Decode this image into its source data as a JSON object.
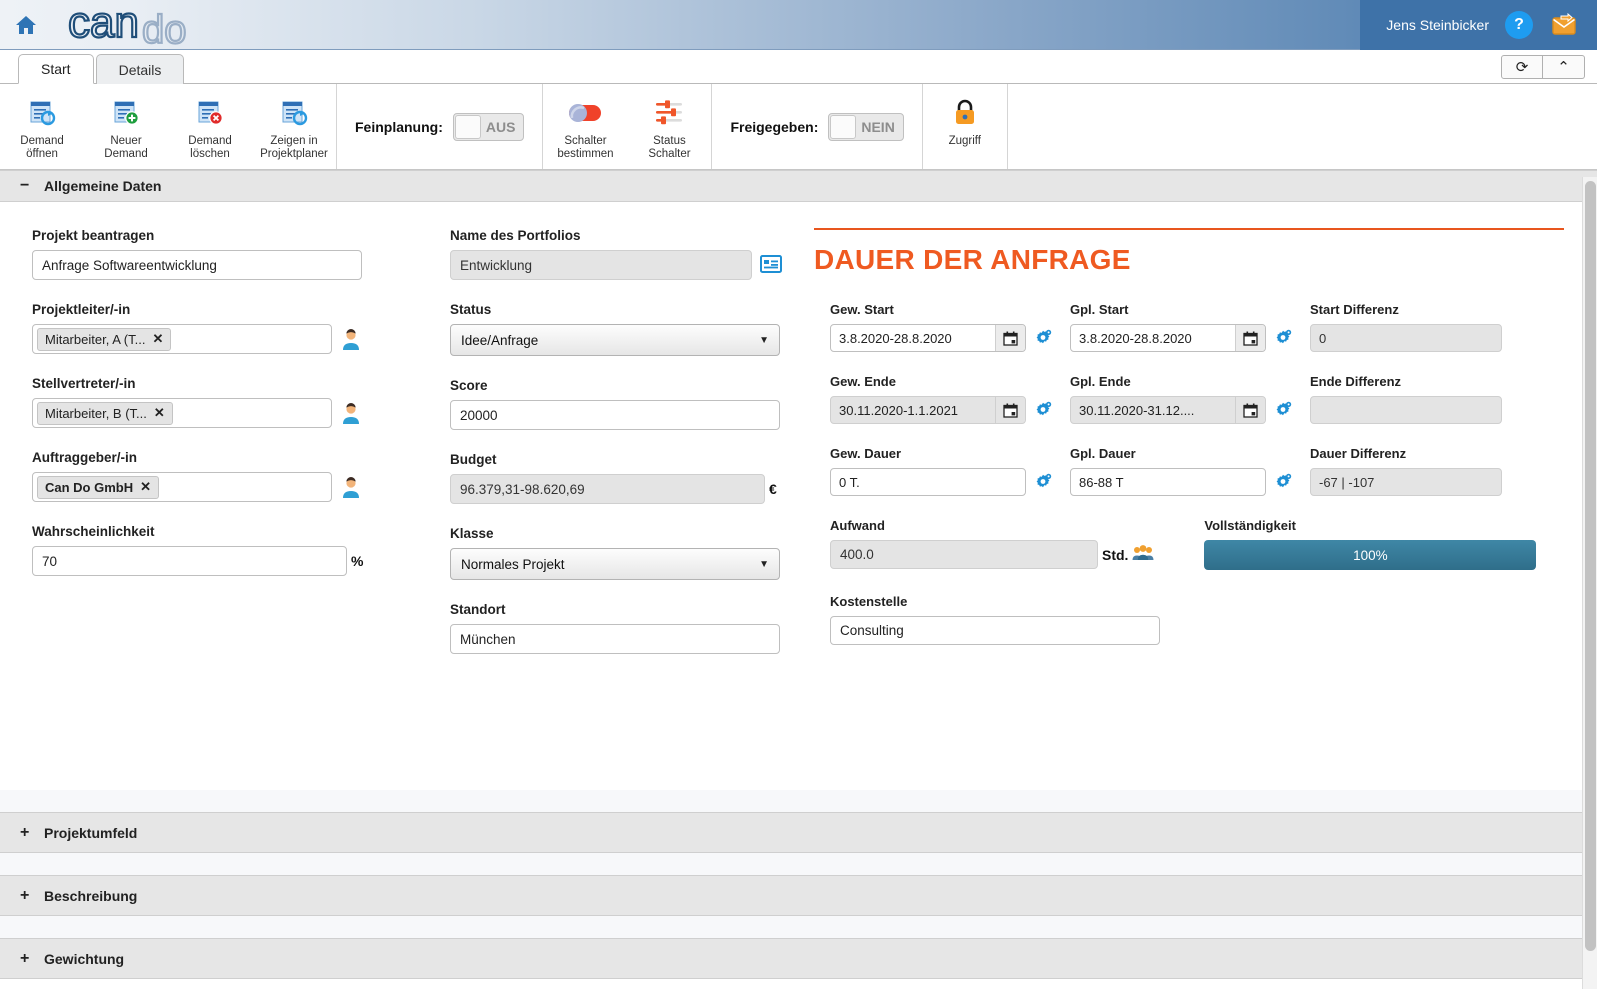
{
  "header": {
    "home_icon": "home-icon",
    "logo_text": "cando",
    "user_name": "Jens Steinbicker",
    "help_icon": "?",
    "mail_icon": "mail-forward-icon"
  },
  "tabs": [
    {
      "label": "Start",
      "active": true
    },
    {
      "label": "Details",
      "active": false
    }
  ],
  "tab_actions": {
    "refresh_icon": "⟳",
    "collapse_icon": "⌃"
  },
  "ribbon": {
    "buttons": [
      {
        "label_line1": "Demand",
        "label_line2": "öffnen",
        "icon": "document-open-icon"
      },
      {
        "label_line1": "Neuer",
        "label_line2": "Demand",
        "icon": "document-add-icon"
      },
      {
        "label_line1": "Demand",
        "label_line2": "löschen",
        "icon": "document-delete-icon"
      },
      {
        "label_line1": "Zeigen in",
        "label_line2": "Projektplaner",
        "icon": "document-open-icon"
      }
    ],
    "feinplanung": {
      "label": "Feinplanung:",
      "value": "AUS"
    },
    "switch_buttons": [
      {
        "label_line1": "Schalter",
        "label_line2": "bestimmen",
        "icon": "toggle-switch-icon"
      },
      {
        "label_line1": "Status",
        "label_line2": "Schalter",
        "icon": "sliders-icon"
      }
    ],
    "freigegeben": {
      "label": "Freigegeben:",
      "value": "NEIN"
    },
    "zugriff": {
      "label": "Zugriff",
      "icon": "lock-icon"
    }
  },
  "sections": {
    "allgemeine_daten": "Allgemeine Daten",
    "collapsed": [
      "Projektumfeld",
      "Beschreibung",
      "Gewichtung"
    ],
    "minus": "−",
    "plus": "+"
  },
  "form": {
    "projekt_beantragen": {
      "label": "Projekt beantragen",
      "value": "Anfrage Softwareentwicklung"
    },
    "projektleiter": {
      "label": "Projektleiter/-in",
      "token": "Mitarbeiter, A (T...",
      "remove": "✕",
      "icon": "person-icon"
    },
    "stellvertreter": {
      "label": "Stellvertreter/-in",
      "token": "Mitarbeiter, B (T...",
      "remove": "✕",
      "icon": "person-icon"
    },
    "auftraggeber": {
      "label": "Auftraggeber/-in",
      "token": "Can Do GmbH",
      "remove": "✕",
      "icon": "person-icon"
    },
    "wahrscheinlichkeit": {
      "label": "Wahrscheinlichkeit",
      "value": "70",
      "suffix": "%"
    },
    "portfolio": {
      "label": "Name des Portfolios",
      "value": "Entwicklung",
      "icon": "list-detail-icon"
    },
    "status": {
      "label": "Status",
      "value": "Idee/Anfrage",
      "caret": "▼"
    },
    "score": {
      "label": "Score",
      "value": "20000"
    },
    "budget": {
      "label": "Budget",
      "value": "96.379,31-98.620,69",
      "suffix": "€"
    },
    "klasse": {
      "label": "Klasse",
      "value": "Normales Projekt",
      "caret": "▼"
    },
    "standort": {
      "label": "Standort",
      "value": "München"
    }
  },
  "panel": {
    "title": "DAUER DER ANFRAGE",
    "accent_color": "#ef5a21",
    "rows": [
      {
        "gew": {
          "label": "Gew. Start",
          "value": "3.8.2020-28.8.2020",
          "readonly": false,
          "calendar": true
        },
        "gpl": {
          "label": "Gpl. Start",
          "value": "3.8.2020-28.8.2020",
          "readonly": false,
          "calendar": true
        },
        "diff": {
          "label": "Start Differenz",
          "value": "0"
        }
      },
      {
        "gew": {
          "label": "Gew. Ende",
          "value": "30.11.2020-1.1.2021",
          "readonly": true,
          "calendar": true
        },
        "gpl": {
          "label": "Gpl. Ende",
          "value": "30.11.2020-31.12....",
          "readonly": true,
          "calendar": true
        },
        "diff": {
          "label": "Ende Differenz",
          "value": ""
        }
      },
      {
        "gew": {
          "label": "Gew. Dauer",
          "value": "0 T.",
          "readonly": false,
          "calendar": false
        },
        "gpl": {
          "label": "Gpl. Dauer",
          "value": "86-88 T",
          "readonly": false,
          "calendar": false
        },
        "diff": {
          "label": "Dauer Differenz",
          "value": "-67 | -107"
        }
      }
    ],
    "aufwand": {
      "label": "Aufwand",
      "value": "400.0",
      "suffix": "Std.",
      "icon": "people-icon"
    },
    "vollstaendigkeit": {
      "label": "Vollständigkeit",
      "value": "100%",
      "percent": 100,
      "color": "#35789a"
    },
    "kostenstelle": {
      "label": "Kostenstelle",
      "value": "Consulting"
    }
  }
}
